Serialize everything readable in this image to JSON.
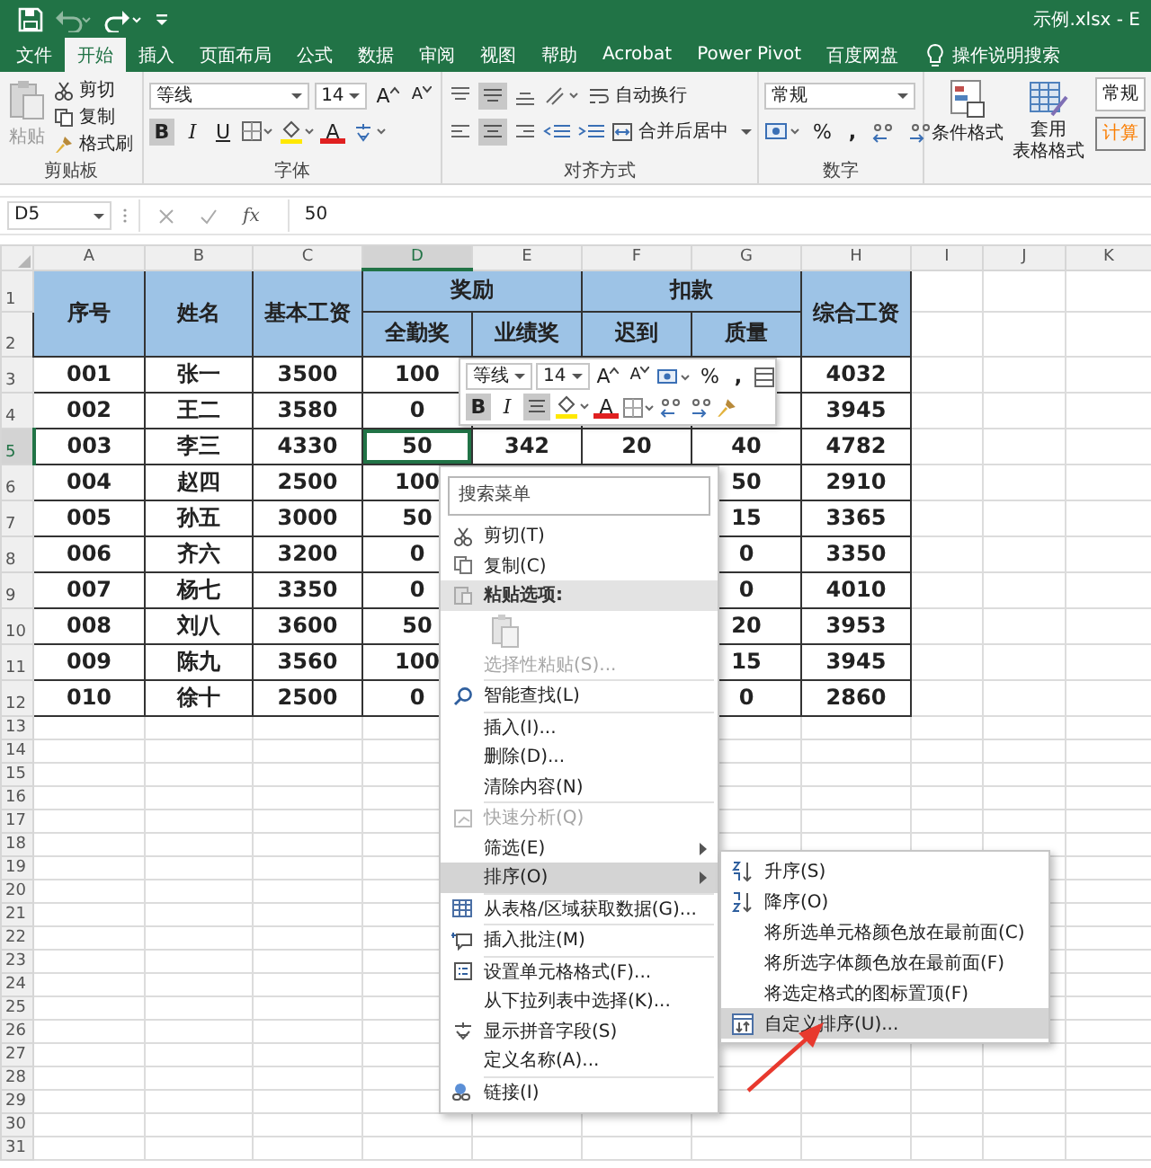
{
  "title_bar": {
    "file_title": "示例.xlsx - E"
  },
  "tabs": [
    {
      "label": "文件",
      "selected": false
    },
    {
      "label": "开始",
      "selected": true
    },
    {
      "label": "插入",
      "selected": false
    },
    {
      "label": "页面布局",
      "selected": false
    },
    {
      "label": "公式",
      "selected": false
    },
    {
      "label": "数据",
      "selected": false
    },
    {
      "label": "审阅",
      "selected": false
    },
    {
      "label": "视图",
      "selected": false
    },
    {
      "label": "帮助",
      "selected": false
    },
    {
      "label": "Acrobat",
      "selected": false
    },
    {
      "label": "Power Pivot",
      "selected": false
    },
    {
      "label": "百度网盘",
      "selected": false
    }
  ],
  "tell_me": "操作说明搜索",
  "ribbon": {
    "clipboard": {
      "paste": "粘贴",
      "cut": "剪切",
      "copy": "复制",
      "format_painter": "格式刷",
      "group": "剪贴板"
    },
    "font": {
      "name": "等线",
      "size": "14",
      "grow": "A",
      "shrink": "A",
      "bold": "B",
      "italic": "I",
      "underline": "U",
      "font_color": "A",
      "bold_on": true,
      "group": "字体"
    },
    "alignment": {
      "wrap": "自动换行",
      "merge": "合并后居中",
      "middle_on": true,
      "center_on": true,
      "group": "对齐方式"
    },
    "number": {
      "format": "常规",
      "percent": "%",
      "comma": ",",
      "group": "数字"
    },
    "styles": {
      "conditional": "条件格式",
      "table_format": [
        "套用",
        "表格格式"
      ],
      "normal": "常规",
      "calc": "计算"
    }
  },
  "formula_bar": {
    "name_box": "D5",
    "fx": "fx",
    "value": "50"
  },
  "sheet": {
    "columns": [
      {
        "label": "A",
        "selected": false
      },
      {
        "label": "B",
        "selected": false
      },
      {
        "label": "C",
        "selected": false
      },
      {
        "label": "D",
        "selected": true
      },
      {
        "label": "E",
        "selected": false
      },
      {
        "label": "F",
        "selected": false
      },
      {
        "label": "G",
        "selected": false
      },
      {
        "label": "H",
        "selected": false
      },
      {
        "label": "I",
        "selected": false
      },
      {
        "label": "J",
        "selected": false
      },
      {
        "label": "K",
        "selected": false
      }
    ],
    "rows": [
      {
        "label": "1",
        "selected": false
      },
      {
        "label": "2",
        "selected": false
      },
      {
        "label": "3",
        "selected": false
      },
      {
        "label": "4",
        "selected": false
      },
      {
        "label": "5",
        "selected": true
      },
      {
        "label": "6",
        "selected": false
      },
      {
        "label": "7",
        "selected": false
      },
      {
        "label": "8",
        "selected": false
      },
      {
        "label": "9",
        "selected": false
      },
      {
        "label": "10",
        "selected": false
      },
      {
        "label": "11",
        "selected": false
      },
      {
        "label": "12",
        "selected": false
      },
      {
        "label": "13",
        "selected": false
      },
      {
        "label": "14",
        "selected": false
      },
      {
        "label": "15",
        "selected": false
      },
      {
        "label": "16",
        "selected": false
      },
      {
        "label": "17",
        "selected": false
      },
      {
        "label": "18",
        "selected": false
      },
      {
        "label": "19",
        "selected": false
      },
      {
        "label": "20",
        "selected": false
      },
      {
        "label": "21",
        "selected": false
      },
      {
        "label": "22",
        "selected": false
      },
      {
        "label": "23",
        "selected": false
      },
      {
        "label": "24",
        "selected": false
      },
      {
        "label": "25",
        "selected": false
      },
      {
        "label": "26",
        "selected": false
      },
      {
        "label": "27",
        "selected": false
      },
      {
        "label": "28",
        "selected": false
      },
      {
        "label": "29",
        "selected": false
      },
      {
        "label": "30",
        "selected": false
      },
      {
        "label": "31",
        "selected": false
      }
    ]
  },
  "table": {
    "headers": [
      "序号",
      "姓名",
      "基本工资",
      "奖励",
      "扣款",
      "综合工资"
    ],
    "subheaders": [
      "全勤奖",
      "业绩奖",
      "迟到",
      "质量"
    ],
    "records": [
      {
        "id": "001",
        "name": "张一",
        "base": "3500",
        "attendance": "100",
        "total": "4032"
      },
      {
        "id": "002",
        "name": "王二",
        "base": "3580",
        "attendance": "0",
        "total": "3945"
      },
      {
        "id": "003",
        "name": "李三",
        "base": "4330",
        "attendance": "50",
        "performance": "342",
        "late": "20",
        "quality": "40",
        "total": "4782"
      },
      {
        "id": "004",
        "name": "赵四",
        "base": "2500",
        "attendance": "100",
        "quality": "50",
        "total": "2910"
      },
      {
        "id": "005",
        "name": "孙五",
        "base": "3000",
        "attendance": "50",
        "quality": "15",
        "total": "3365"
      },
      {
        "id": "006",
        "name": "齐六",
        "base": "3200",
        "attendance": "0",
        "quality": "0",
        "total": "3350"
      },
      {
        "id": "007",
        "name": "杨七",
        "base": "3350",
        "attendance": "0",
        "quality": "0",
        "total": "4010"
      },
      {
        "id": "008",
        "name": "刘八",
        "base": "3600",
        "attendance": "50",
        "quality": "20",
        "total": "3953"
      },
      {
        "id": "009",
        "name": "陈九",
        "base": "3560",
        "attendance": "100",
        "quality": "15",
        "total": "3945"
      },
      {
        "id": "010",
        "name": "徐十",
        "base": "2500",
        "attendance": "0",
        "quality": "0",
        "total": "2860"
      }
    ]
  },
  "mini_toolbar": {
    "font": "等线",
    "size": "14",
    "grow": "A",
    "shrink": "A",
    "percent": "%",
    "comma": ",",
    "bold": "B",
    "italic": "I",
    "font_color": "A",
    "bold_on": true,
    "center_on": true
  },
  "context_menu": {
    "search_placeholder": "搜索菜单",
    "items": [
      {
        "kind": "item",
        "label": "剪切(T)",
        "disabled": false,
        "selected": false,
        "submenu": false
      },
      {
        "kind": "item",
        "label": "复制(C)",
        "disabled": false,
        "selected": false,
        "submenu": false
      },
      {
        "kind": "header",
        "label": "粘贴选项:"
      },
      {
        "kind": "paste-options",
        "disabled": true
      },
      {
        "kind": "item",
        "label": "选择性粘贴(S)...",
        "disabled": true,
        "selected": false,
        "submenu": false
      },
      {
        "kind": "item",
        "label": "智能查找(L)",
        "disabled": false,
        "selected": false,
        "submenu": false,
        "divider_above": true
      },
      {
        "kind": "item",
        "label": "插入(I)...",
        "disabled": false,
        "selected": false,
        "submenu": false,
        "divider_above": true
      },
      {
        "kind": "item",
        "label": "删除(D)...",
        "disabled": false,
        "selected": false,
        "submenu": false
      },
      {
        "kind": "item",
        "label": "清除内容(N)",
        "disabled": false,
        "selected": false,
        "submenu": false
      },
      {
        "kind": "item",
        "label": "快速分析(Q)",
        "disabled": true,
        "selected": false,
        "submenu": false,
        "divider_above": true
      },
      {
        "kind": "item",
        "label": "筛选(E)",
        "disabled": false,
        "selected": false,
        "submenu": true
      },
      {
        "kind": "item",
        "label": "排序(O)",
        "disabled": false,
        "selected": true,
        "submenu": true
      },
      {
        "kind": "item",
        "label": "从表格/区域获取数据(G)...",
        "disabled": false,
        "selected": false,
        "submenu": false,
        "divider_above": true
      },
      {
        "kind": "item",
        "label": "插入批注(M)",
        "disabled": false,
        "selected": false,
        "submenu": false,
        "divider_above": true
      },
      {
        "kind": "item",
        "label": "设置单元格格式(F)...",
        "disabled": false,
        "selected": false,
        "submenu": false,
        "divider_above": true
      },
      {
        "kind": "item",
        "label": "从下拉列表中选择(K)...",
        "disabled": false,
        "selected": false,
        "submenu": false
      },
      {
        "kind": "item",
        "label": "显示拼音字段(S)",
        "disabled": false,
        "selected": false,
        "submenu": false
      },
      {
        "kind": "item",
        "label": "定义名称(A)...",
        "disabled": false,
        "selected": false,
        "submenu": false
      },
      {
        "kind": "item",
        "label": "链接(I)",
        "disabled": false,
        "selected": false,
        "submenu": false,
        "divider_above": true
      }
    ]
  },
  "sort_submenu": [
    {
      "label": "升序(S)",
      "selected": false
    },
    {
      "label": "降序(O)",
      "selected": false
    },
    {
      "label": "将所选单元格颜色放在最前面(C)",
      "selected": false
    },
    {
      "label": "将所选字体颜色放在最前面(F)",
      "selected": false
    },
    {
      "label": "将选定格式的图标置顶(F)",
      "selected": false
    },
    {
      "label": "自定义排序(U)...",
      "selected": true
    }
  ]
}
